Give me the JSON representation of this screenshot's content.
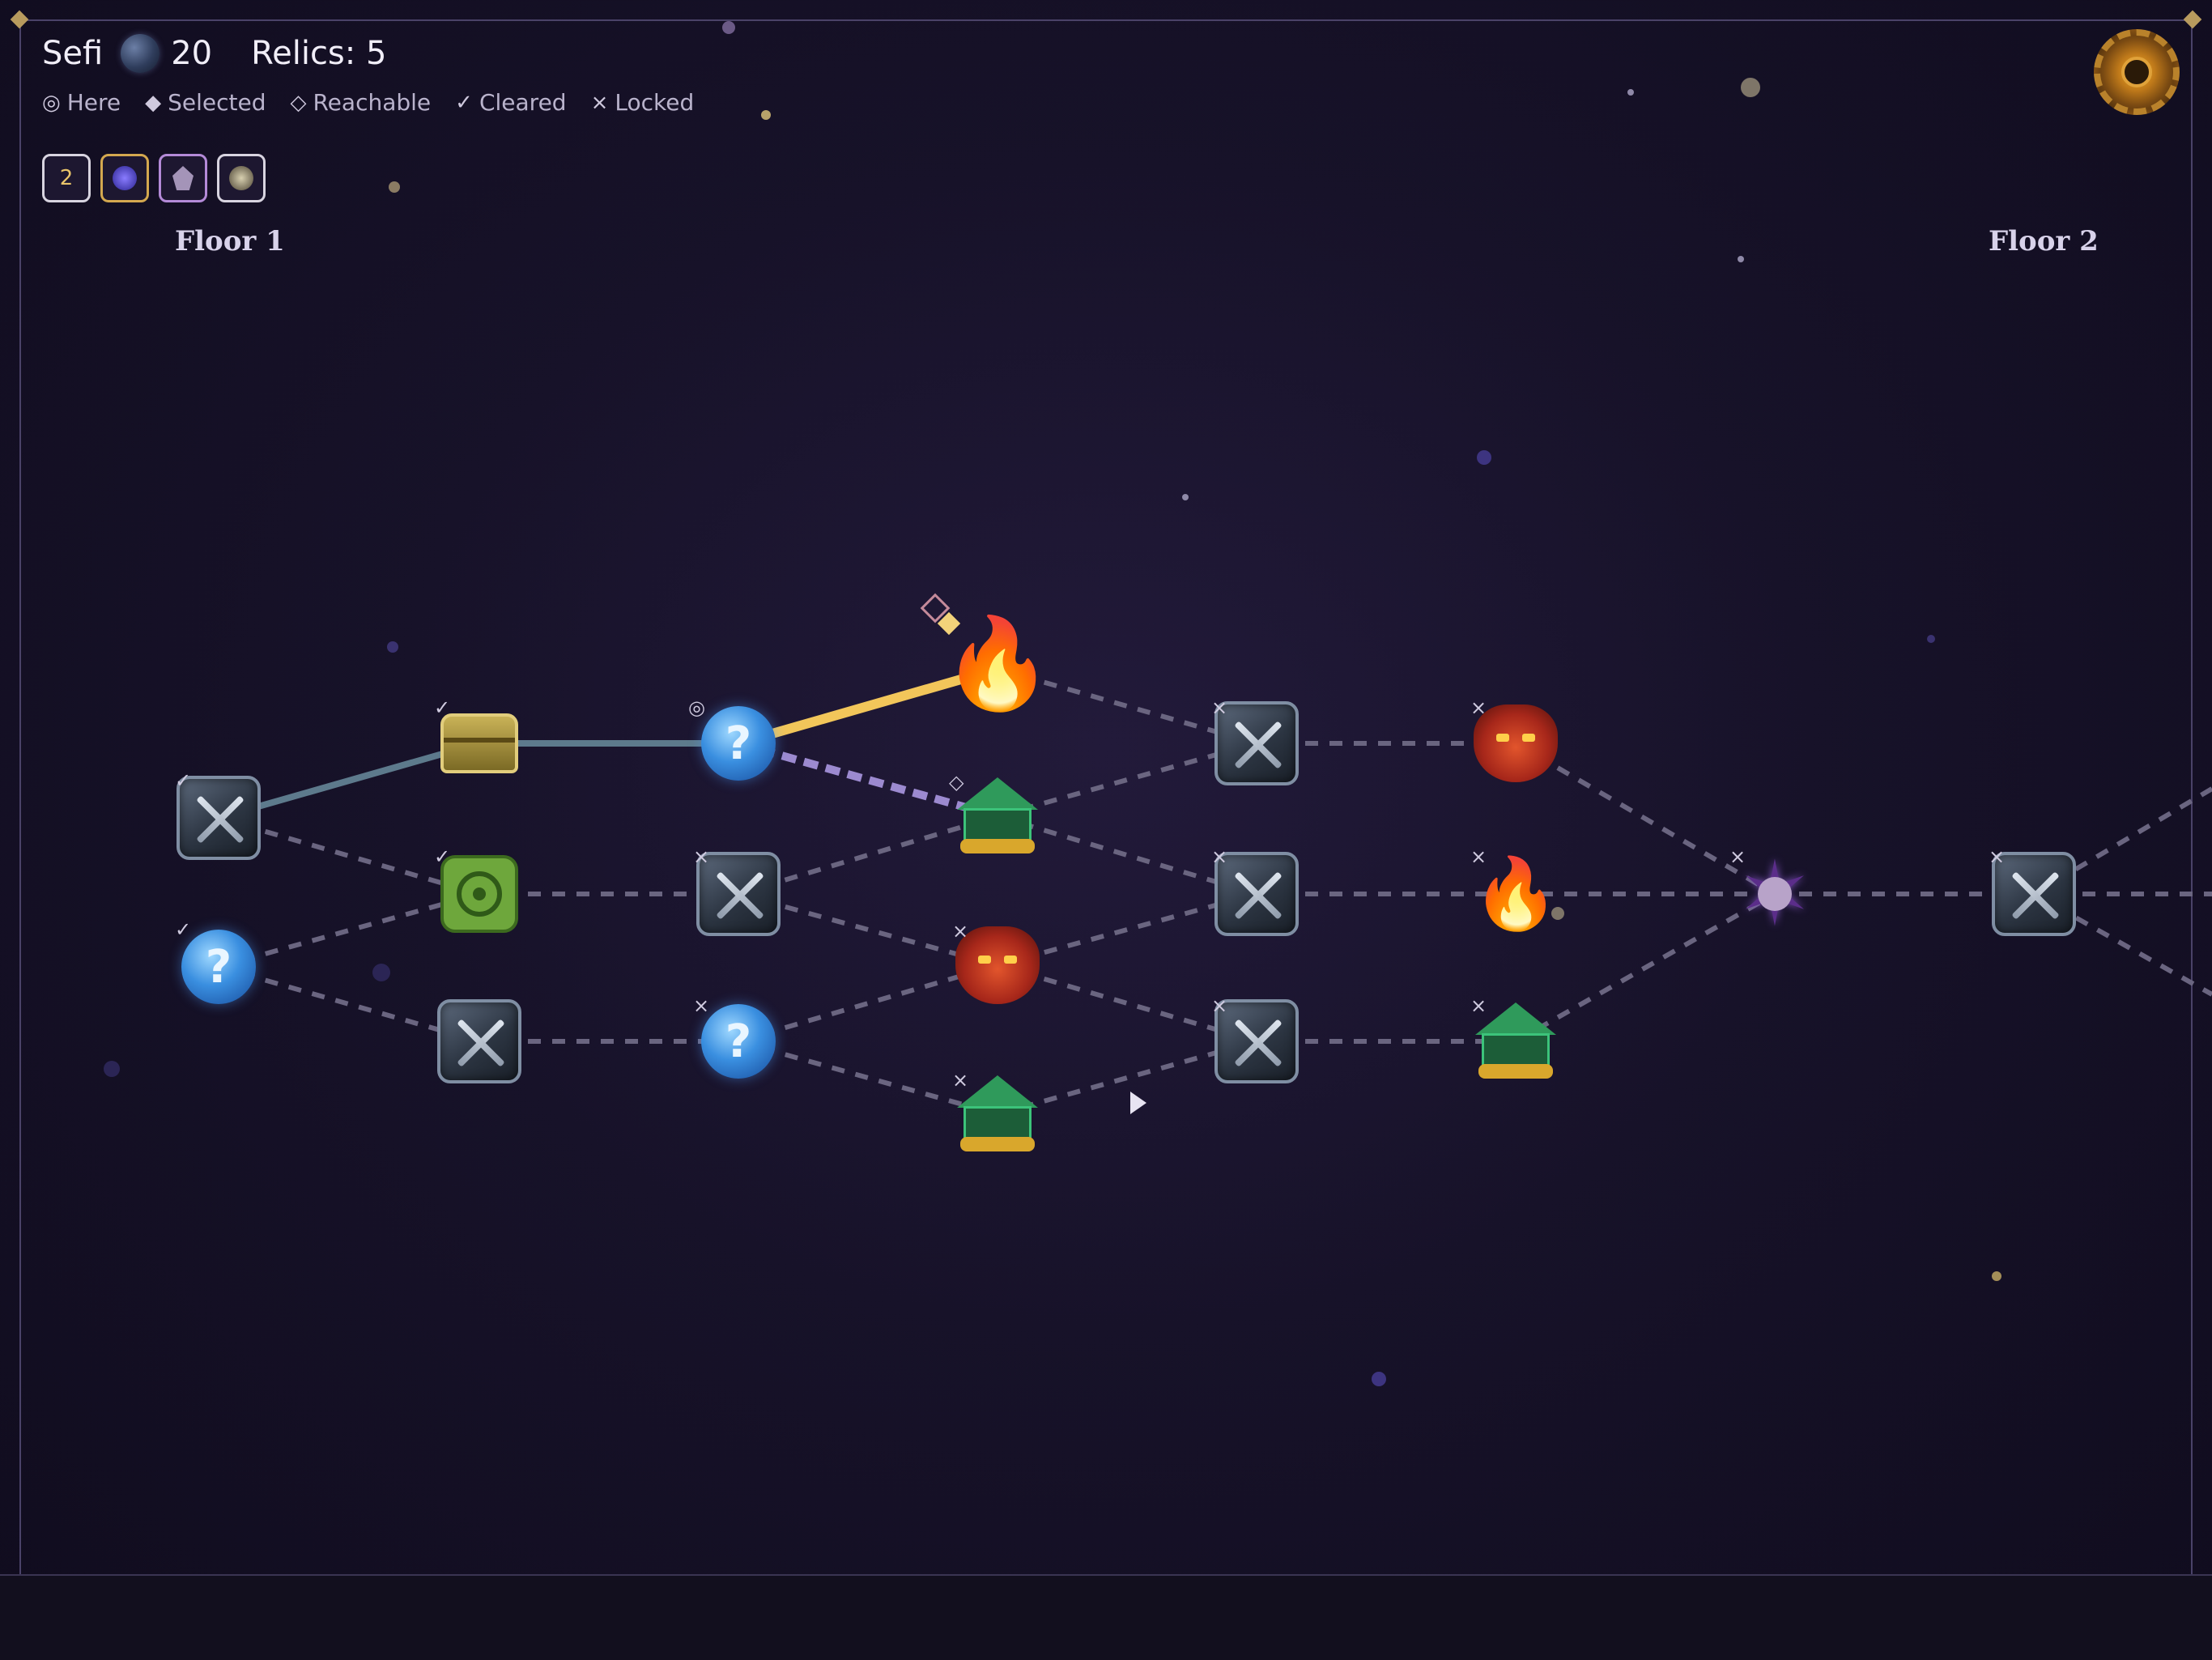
{
  "player": {
    "name": "Sefi",
    "currency_icon": "orb-icon",
    "currency": "20",
    "relics_label": "Relics: 5"
  },
  "legend": [
    {
      "symbol": "◎",
      "label": "Here",
      "icon": "here-icon"
    },
    {
      "symbol": "◆",
      "label": "Selected",
      "icon": "selected-icon"
    },
    {
      "symbol": "◇",
      "label": "Reachable",
      "icon": "reachable-icon"
    },
    {
      "symbol": "✓",
      "label": "Cleared",
      "icon": "cleared-icon"
    },
    {
      "symbol": "×",
      "label": "Locked",
      "icon": "locked-icon"
    }
  ],
  "relics": [
    {
      "icon": "sword-relic-icon",
      "badge": "2"
    },
    {
      "icon": "blue-orb-relic-icon"
    },
    {
      "icon": "crystal-relic-icon"
    },
    {
      "icon": "eye-relic-icon"
    }
  ],
  "floors": {
    "floor1": "Floor 1",
    "floor2": "Floor 2"
  },
  "settings": {
    "icon": "gear-icon"
  },
  "map": {
    "status_symbols": {
      "cleared": "✓",
      "here": "◎",
      "reachable": "◇",
      "locked": "×"
    },
    "nodes": [
      {
        "id": "n1a",
        "type": "battle",
        "status": "cleared"
      },
      {
        "id": "n1b",
        "type": "mystery",
        "status": "cleared"
      },
      {
        "id": "n2a",
        "type": "treasure",
        "status": "cleared"
      },
      {
        "id": "n2b",
        "type": "target",
        "status": "cleared"
      },
      {
        "id": "n2c",
        "type": "battle",
        "status": "cleared"
      },
      {
        "id": "n3a",
        "type": "mystery",
        "status": "here"
      },
      {
        "id": "n3b",
        "type": "battle",
        "status": "locked"
      },
      {
        "id": "n3c",
        "type": "mystery",
        "status": "locked"
      },
      {
        "id": "n4a",
        "type": "campfire",
        "status": "selected"
      },
      {
        "id": "n4b",
        "type": "shop",
        "status": "reachable"
      },
      {
        "id": "n4c",
        "type": "elite",
        "status": "locked"
      },
      {
        "id": "n4d",
        "type": "shop",
        "status": "locked"
      },
      {
        "id": "n5a",
        "type": "battle",
        "status": "locked"
      },
      {
        "id": "n5b",
        "type": "battle",
        "status": "locked"
      },
      {
        "id": "n5c",
        "type": "battle",
        "status": "locked"
      },
      {
        "id": "n6a",
        "type": "elite",
        "status": "locked"
      },
      {
        "id": "n6b",
        "type": "campfire",
        "status": "locked"
      },
      {
        "id": "n6c",
        "type": "shop",
        "status": "locked"
      },
      {
        "id": "n7",
        "type": "boss",
        "status": "locked"
      },
      {
        "id": "n8",
        "type": "battle",
        "status": "locked"
      }
    ]
  }
}
